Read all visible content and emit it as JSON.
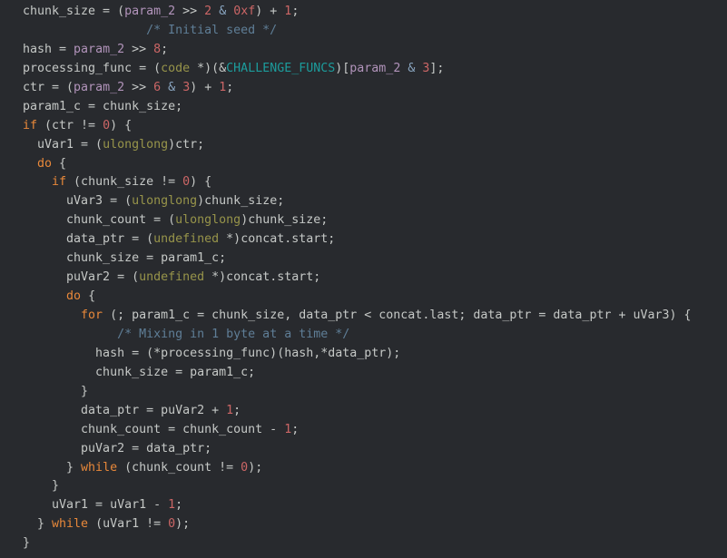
{
  "window": {
    "kind": "decompiler-code-view",
    "background_color": "#282a2e"
  },
  "theme": {
    "plain": "#c5c8c6",
    "keyword": "#e8883a",
    "type": "#97944a",
    "number": "#cc6666",
    "parameter": "#b294bb",
    "comment": "#5f7e97",
    "global_symbol": "#1c9c9c",
    "operator": "#8aa6c1"
  },
  "code": {
    "language": "c",
    "lines": [
      {
        "indent": 0,
        "tokens": [
          {
            "t": "chunk_size = ",
            "c": "plain"
          },
          {
            "t": "(",
            "c": "punct"
          },
          {
            "t": "param_2",
            "c": "param"
          },
          {
            "t": " >> ",
            "c": "plain"
          },
          {
            "t": "2",
            "c": "num"
          },
          {
            "t": " ",
            "c": "plain"
          },
          {
            "t": "&",
            "c": "op"
          },
          {
            "t": " ",
            "c": "plain"
          },
          {
            "t": "0xf",
            "c": "num"
          },
          {
            "t": ") + ",
            "c": "plain"
          },
          {
            "t": "1",
            "c": "num"
          },
          {
            "t": ";",
            "c": "plain"
          }
        ]
      },
      {
        "indent": 0,
        "tokens": [
          {
            "t": "                 ",
            "c": "plain"
          },
          {
            "t": "/* Initial seed */",
            "c": "comment"
          }
        ]
      },
      {
        "indent": 0,
        "tokens": [
          {
            "t": "hash = ",
            "c": "plain"
          },
          {
            "t": "param_2",
            "c": "param"
          },
          {
            "t": " >> ",
            "c": "plain"
          },
          {
            "t": "8",
            "c": "num"
          },
          {
            "t": ";",
            "c": "plain"
          }
        ]
      },
      {
        "indent": 0,
        "tokens": [
          {
            "t": "processing_func = (",
            "c": "plain"
          },
          {
            "t": "code",
            "c": "type"
          },
          {
            "t": " *)(&",
            "c": "plain"
          },
          {
            "t": "CHALLENGE_FUNCS",
            "c": "global"
          },
          {
            "t": ")[",
            "c": "plain"
          },
          {
            "t": "param_2",
            "c": "param"
          },
          {
            "t": " ",
            "c": "plain"
          },
          {
            "t": "&",
            "c": "op"
          },
          {
            "t": " ",
            "c": "plain"
          },
          {
            "t": "3",
            "c": "num"
          },
          {
            "t": "];",
            "c": "plain"
          }
        ]
      },
      {
        "indent": 0,
        "tokens": [
          {
            "t": "ctr = (",
            "c": "plain"
          },
          {
            "t": "param_2",
            "c": "param"
          },
          {
            "t": " >> ",
            "c": "plain"
          },
          {
            "t": "6",
            "c": "num"
          },
          {
            "t": " ",
            "c": "plain"
          },
          {
            "t": "&",
            "c": "op"
          },
          {
            "t": " ",
            "c": "plain"
          },
          {
            "t": "3",
            "c": "num"
          },
          {
            "t": ") + ",
            "c": "plain"
          },
          {
            "t": "1",
            "c": "num"
          },
          {
            "t": ";",
            "c": "plain"
          }
        ]
      },
      {
        "indent": 0,
        "tokens": [
          {
            "t": "param1_c = chunk_size;",
            "c": "plain"
          }
        ]
      },
      {
        "indent": 0,
        "tokens": [
          {
            "t": "if",
            "c": "kw"
          },
          {
            "t": " (ctr != ",
            "c": "plain"
          },
          {
            "t": "0",
            "c": "num"
          },
          {
            "t": ") {",
            "c": "plain"
          }
        ]
      },
      {
        "indent": 0,
        "tokens": [
          {
            "t": "  uVar1 = (",
            "c": "plain"
          },
          {
            "t": "ulonglong",
            "c": "type"
          },
          {
            "t": ")ctr;",
            "c": "plain"
          }
        ]
      },
      {
        "indent": 0,
        "tokens": [
          {
            "t": "  ",
            "c": "plain"
          },
          {
            "t": "do",
            "c": "kw"
          },
          {
            "t": " {",
            "c": "plain"
          }
        ]
      },
      {
        "indent": 0,
        "tokens": [
          {
            "t": "    ",
            "c": "plain"
          },
          {
            "t": "if",
            "c": "kw"
          },
          {
            "t": " (chunk_size != ",
            "c": "plain"
          },
          {
            "t": "0",
            "c": "num"
          },
          {
            "t": ") {",
            "c": "plain"
          }
        ]
      },
      {
        "indent": 0,
        "tokens": [
          {
            "t": "      uVar3 = (",
            "c": "plain"
          },
          {
            "t": "ulonglong",
            "c": "type"
          },
          {
            "t": ")chunk_size;",
            "c": "plain"
          }
        ]
      },
      {
        "indent": 0,
        "tokens": [
          {
            "t": "      chunk_count = (",
            "c": "plain"
          },
          {
            "t": "ulonglong",
            "c": "type"
          },
          {
            "t": ")chunk_size;",
            "c": "plain"
          }
        ]
      },
      {
        "indent": 0,
        "tokens": [
          {
            "t": "      data_ptr = (",
            "c": "plain"
          },
          {
            "t": "undefined",
            "c": "type"
          },
          {
            "t": " *)concat.start;",
            "c": "plain"
          }
        ]
      },
      {
        "indent": 0,
        "tokens": [
          {
            "t": "      chunk_size = param1_c;",
            "c": "plain"
          }
        ]
      },
      {
        "indent": 0,
        "tokens": [
          {
            "t": "      puVar2 = (",
            "c": "plain"
          },
          {
            "t": "undefined",
            "c": "type"
          },
          {
            "t": " *)concat.start;",
            "c": "plain"
          }
        ]
      },
      {
        "indent": 0,
        "tokens": [
          {
            "t": "      ",
            "c": "plain"
          },
          {
            "t": "do",
            "c": "kw"
          },
          {
            "t": " {",
            "c": "plain"
          }
        ]
      },
      {
        "indent": 0,
        "tokens": [
          {
            "t": "        ",
            "c": "plain"
          },
          {
            "t": "for",
            "c": "kw"
          },
          {
            "t": " (; param1_c = chunk_size, data_ptr < concat.last; data_ptr = data_ptr + uVar3) {",
            "c": "plain"
          }
        ]
      },
      {
        "indent": 0,
        "tokens": [
          {
            "t": "             ",
            "c": "plain"
          },
          {
            "t": "/* Mixing in 1 byte at a time */",
            "c": "comment"
          }
        ]
      },
      {
        "indent": 0,
        "tokens": [
          {
            "t": "          hash = (*processing_func)(hash,*data_ptr);",
            "c": "plain"
          }
        ]
      },
      {
        "indent": 0,
        "tokens": [
          {
            "t": "          chunk_size = param1_c;",
            "c": "plain"
          }
        ]
      },
      {
        "indent": 0,
        "tokens": [
          {
            "t": "        }",
            "c": "plain"
          }
        ]
      },
      {
        "indent": 0,
        "tokens": [
          {
            "t": "        data_ptr = puVar2 + ",
            "c": "plain"
          },
          {
            "t": "1",
            "c": "num"
          },
          {
            "t": ";",
            "c": "plain"
          }
        ]
      },
      {
        "indent": 0,
        "tokens": [
          {
            "t": "        chunk_count = chunk_count - ",
            "c": "plain"
          },
          {
            "t": "1",
            "c": "num"
          },
          {
            "t": ";",
            "c": "plain"
          }
        ]
      },
      {
        "indent": 0,
        "tokens": [
          {
            "t": "        puVar2 = data_ptr;",
            "c": "plain"
          }
        ]
      },
      {
        "indent": 0,
        "tokens": [
          {
            "t": "      } ",
            "c": "plain"
          },
          {
            "t": "while",
            "c": "kw"
          },
          {
            "t": " (chunk_count != ",
            "c": "plain"
          },
          {
            "t": "0",
            "c": "num"
          },
          {
            "t": ");",
            "c": "plain"
          }
        ]
      },
      {
        "indent": 0,
        "tokens": [
          {
            "t": "    }",
            "c": "plain"
          }
        ]
      },
      {
        "indent": 0,
        "tokens": [
          {
            "t": "    uVar1 = uVar1 - ",
            "c": "plain"
          },
          {
            "t": "1",
            "c": "num"
          },
          {
            "t": ";",
            "c": "plain"
          }
        ]
      },
      {
        "indent": 0,
        "tokens": [
          {
            "t": "  } ",
            "c": "plain"
          },
          {
            "t": "while",
            "c": "kw"
          },
          {
            "t": " (uVar1 != ",
            "c": "plain"
          },
          {
            "t": "0",
            "c": "num"
          },
          {
            "t": ");",
            "c": "plain"
          }
        ]
      },
      {
        "indent": 0,
        "tokens": [
          {
            "t": "}",
            "c": "plain"
          }
        ]
      }
    ]
  }
}
